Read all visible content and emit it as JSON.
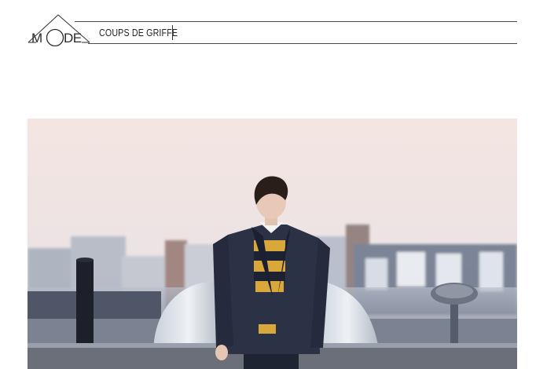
{
  "header": {
    "logo_text": "MODE",
    "section_title": "COUPS DE GRIFFE"
  },
  "photo": {
    "description_icon": "fashion-photo-rooftop"
  },
  "colors": {
    "rule": "#4a4a4a",
    "sky": "#f3e6e2",
    "jacket": "#2b3245",
    "stripe": "#d8a83a"
  }
}
